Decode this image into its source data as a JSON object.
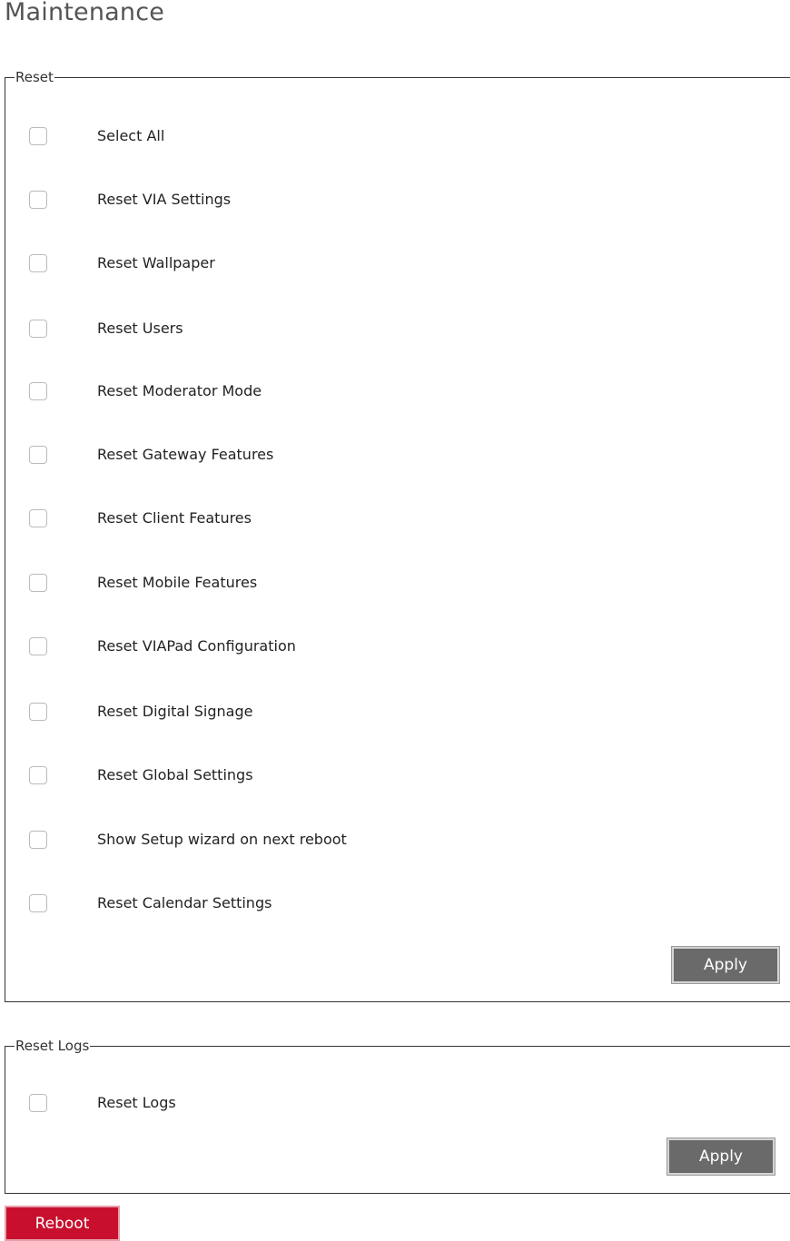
{
  "page": {
    "title": "Maintenance"
  },
  "reset_group": {
    "legend": "Reset",
    "items": [
      {
        "label": "Select All",
        "checked": false
      },
      {
        "label": "Reset VIA Settings",
        "checked": false
      },
      {
        "label": "Reset Wallpaper",
        "checked": false
      },
      {
        "label": "Reset Users",
        "checked": false
      },
      {
        "label": "Reset Moderator Mode",
        "checked": false
      },
      {
        "label": "Reset Gateway Features",
        "checked": false
      },
      {
        "label": "Reset Client Features",
        "checked": false
      },
      {
        "label": "Reset Mobile Features",
        "checked": false
      },
      {
        "label": "Reset VIAPad Configuration",
        "checked": false
      },
      {
        "label": "Reset Digital Signage",
        "checked": false
      },
      {
        "label": "Reset Global Settings",
        "checked": false
      },
      {
        "label": "Show Setup wizard on next reboot",
        "checked": false
      },
      {
        "label": "Reset Calendar Settings",
        "checked": false
      }
    ],
    "apply_label": "Apply"
  },
  "logs_group": {
    "legend": "Reset Logs",
    "items": [
      {
        "label": "Reset Logs",
        "checked": false
      }
    ],
    "apply_label": "Apply"
  },
  "reboot_label": "Reboot",
  "colors": {
    "reboot_button": "#c8102e",
    "apply_button": "#6a6a6a",
    "title_text": "#555555"
  }
}
